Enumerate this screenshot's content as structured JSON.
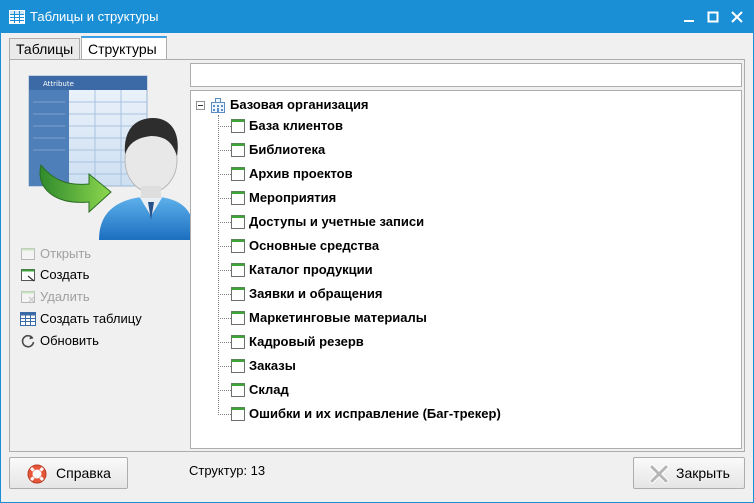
{
  "window": {
    "title": "Таблицы и структуры",
    "accent": "#1b8fd6"
  },
  "tabs": [
    {
      "label": "Таблицы",
      "active": false
    },
    {
      "label": "Структуры",
      "active": true
    }
  ],
  "actions": [
    {
      "label": "Открыть",
      "icon": "open-table-icon",
      "enabled": false
    },
    {
      "label": "Создать",
      "icon": "create-icon",
      "enabled": true
    },
    {
      "label": "Удалить",
      "icon": "delete-icon",
      "enabled": false
    },
    {
      "label": "Создать таблицу",
      "icon": "create-table-icon",
      "enabled": true
    },
    {
      "label": "Обновить",
      "icon": "refresh-icon",
      "enabled": true
    }
  ],
  "illustration": {
    "sheet_header": "Attribute"
  },
  "filter": {
    "value": "",
    "placeholder": ""
  },
  "tree": {
    "root": "Базовая организация",
    "items": [
      "База клиентов",
      "Библиотека",
      "Архив проектов",
      "Мероприятия",
      "Доступы и учетные записи",
      "Основные средства",
      "Каталог продукции",
      "Заявки и обращения",
      "Маркетинговые материалы",
      "Кадровый резерв",
      "Заказы",
      "Склад",
      "Ошибки и их исправление (Баг-трекер)"
    ]
  },
  "footer": {
    "help_label": "Справка",
    "status_text": "Структур:  13",
    "close_label": "Закрыть"
  }
}
